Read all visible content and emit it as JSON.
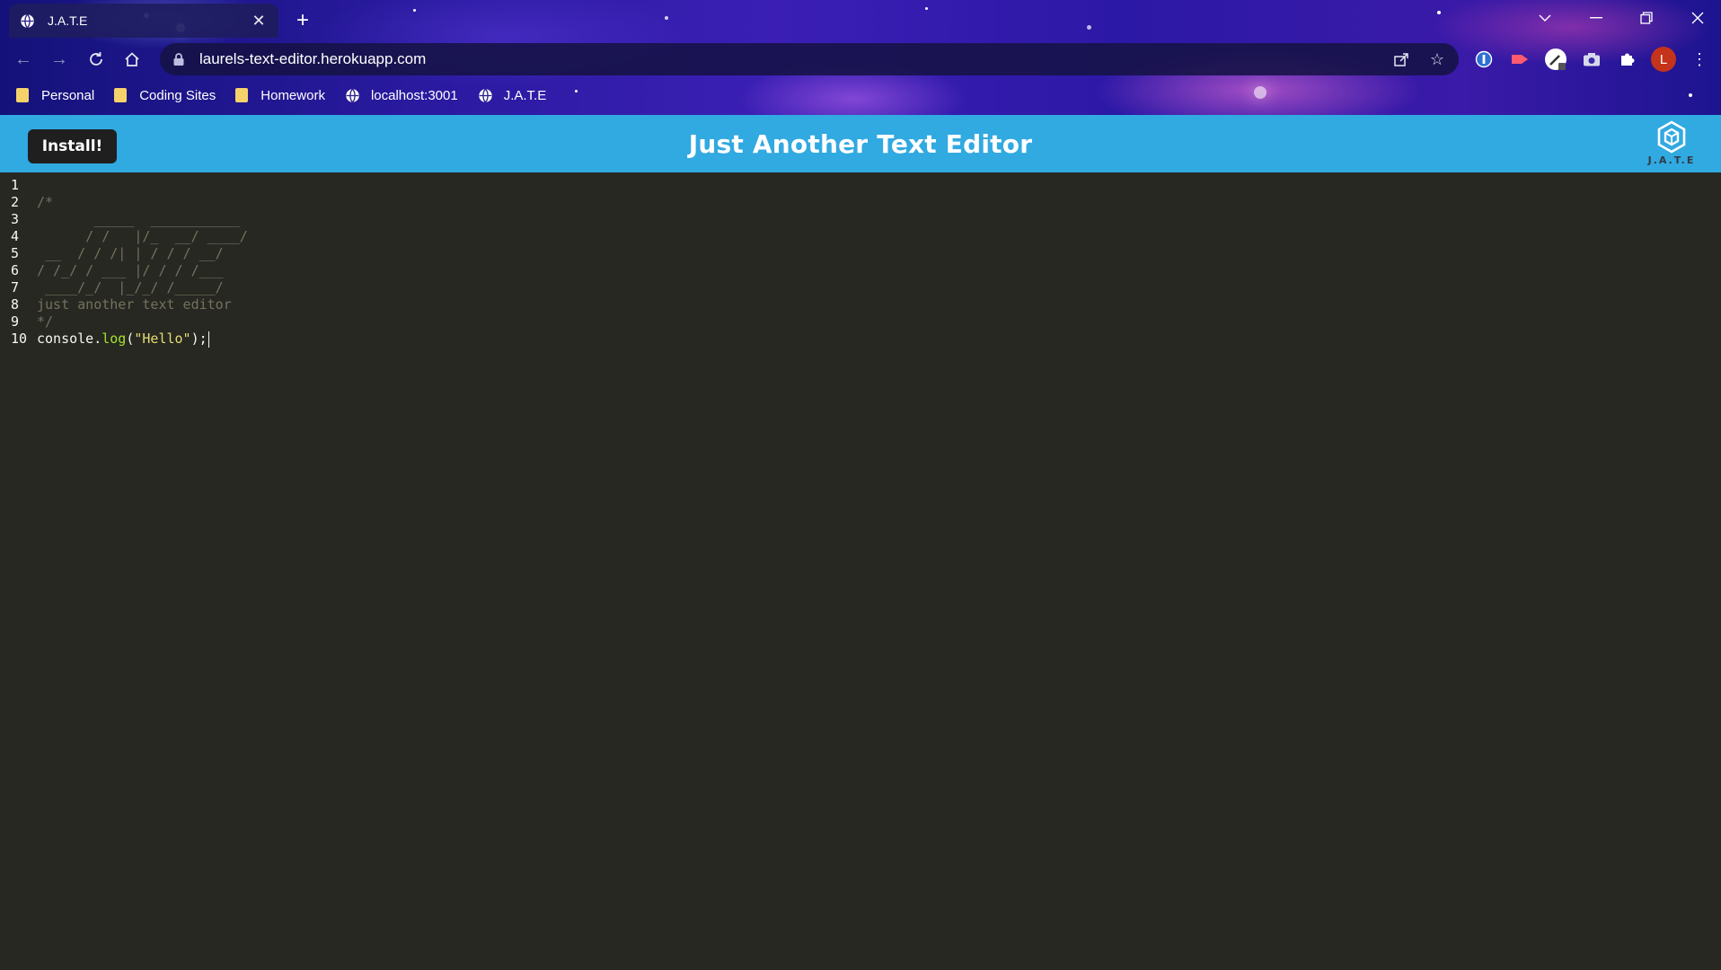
{
  "browser": {
    "tab": {
      "title": "J.A.T.E",
      "close_icon": "close-icon",
      "favicon": "globe-icon"
    },
    "new_tab_label": "+",
    "window_controls": [
      "tab-search-icon",
      "minimize-icon",
      "restore-icon",
      "close-icon"
    ],
    "omnibox": {
      "url": "laurels-text-editor.herokuapp.com"
    },
    "bookmarks": [
      {
        "label": "Personal",
        "icon": "folder-icon"
      },
      {
        "label": "Coding Sites",
        "icon": "folder-icon"
      },
      {
        "label": "Homework",
        "icon": "folder-icon"
      },
      {
        "label": "localhost:3001",
        "icon": "globe-icon"
      },
      {
        "label": "J.A.T.E",
        "icon": "globe-icon"
      }
    ],
    "profile_initial": "L"
  },
  "app": {
    "install_label": "Install!",
    "title": "Just Another Text Editor",
    "logo_text": "J.A.T.E",
    "colors": {
      "header": "#31a9e1",
      "editor_bg": "#272822",
      "comment": "#75715e",
      "function": "#a6e22e",
      "string": "#e6db74"
    }
  },
  "editor": {
    "lines": [
      {
        "num": "1",
        "text": ""
      },
      {
        "num": "2",
        "text": "/*"
      },
      {
        "num": "3",
        "text": "       _____  ___________ "
      },
      {
        "num": "4",
        "text": "      / /   |/_  __/ ____/"
      },
      {
        "num": "5",
        "text": " __  / / /| | / / / __/   "
      },
      {
        "num": "6",
        "text": "/ /_/ / ___ |/ / / /___   "
      },
      {
        "num": "7",
        "text": " ____/_/  |_/_/ /_____/   "
      },
      {
        "num": "8",
        "text": "just another text editor"
      },
      {
        "num": "9",
        "text": "*/"
      },
      {
        "num": "10",
        "text": ""
      }
    ],
    "last_line": {
      "obj": "console.",
      "fn": "log",
      "open": "(",
      "str": "\"Hello\"",
      "close": ");"
    }
  }
}
